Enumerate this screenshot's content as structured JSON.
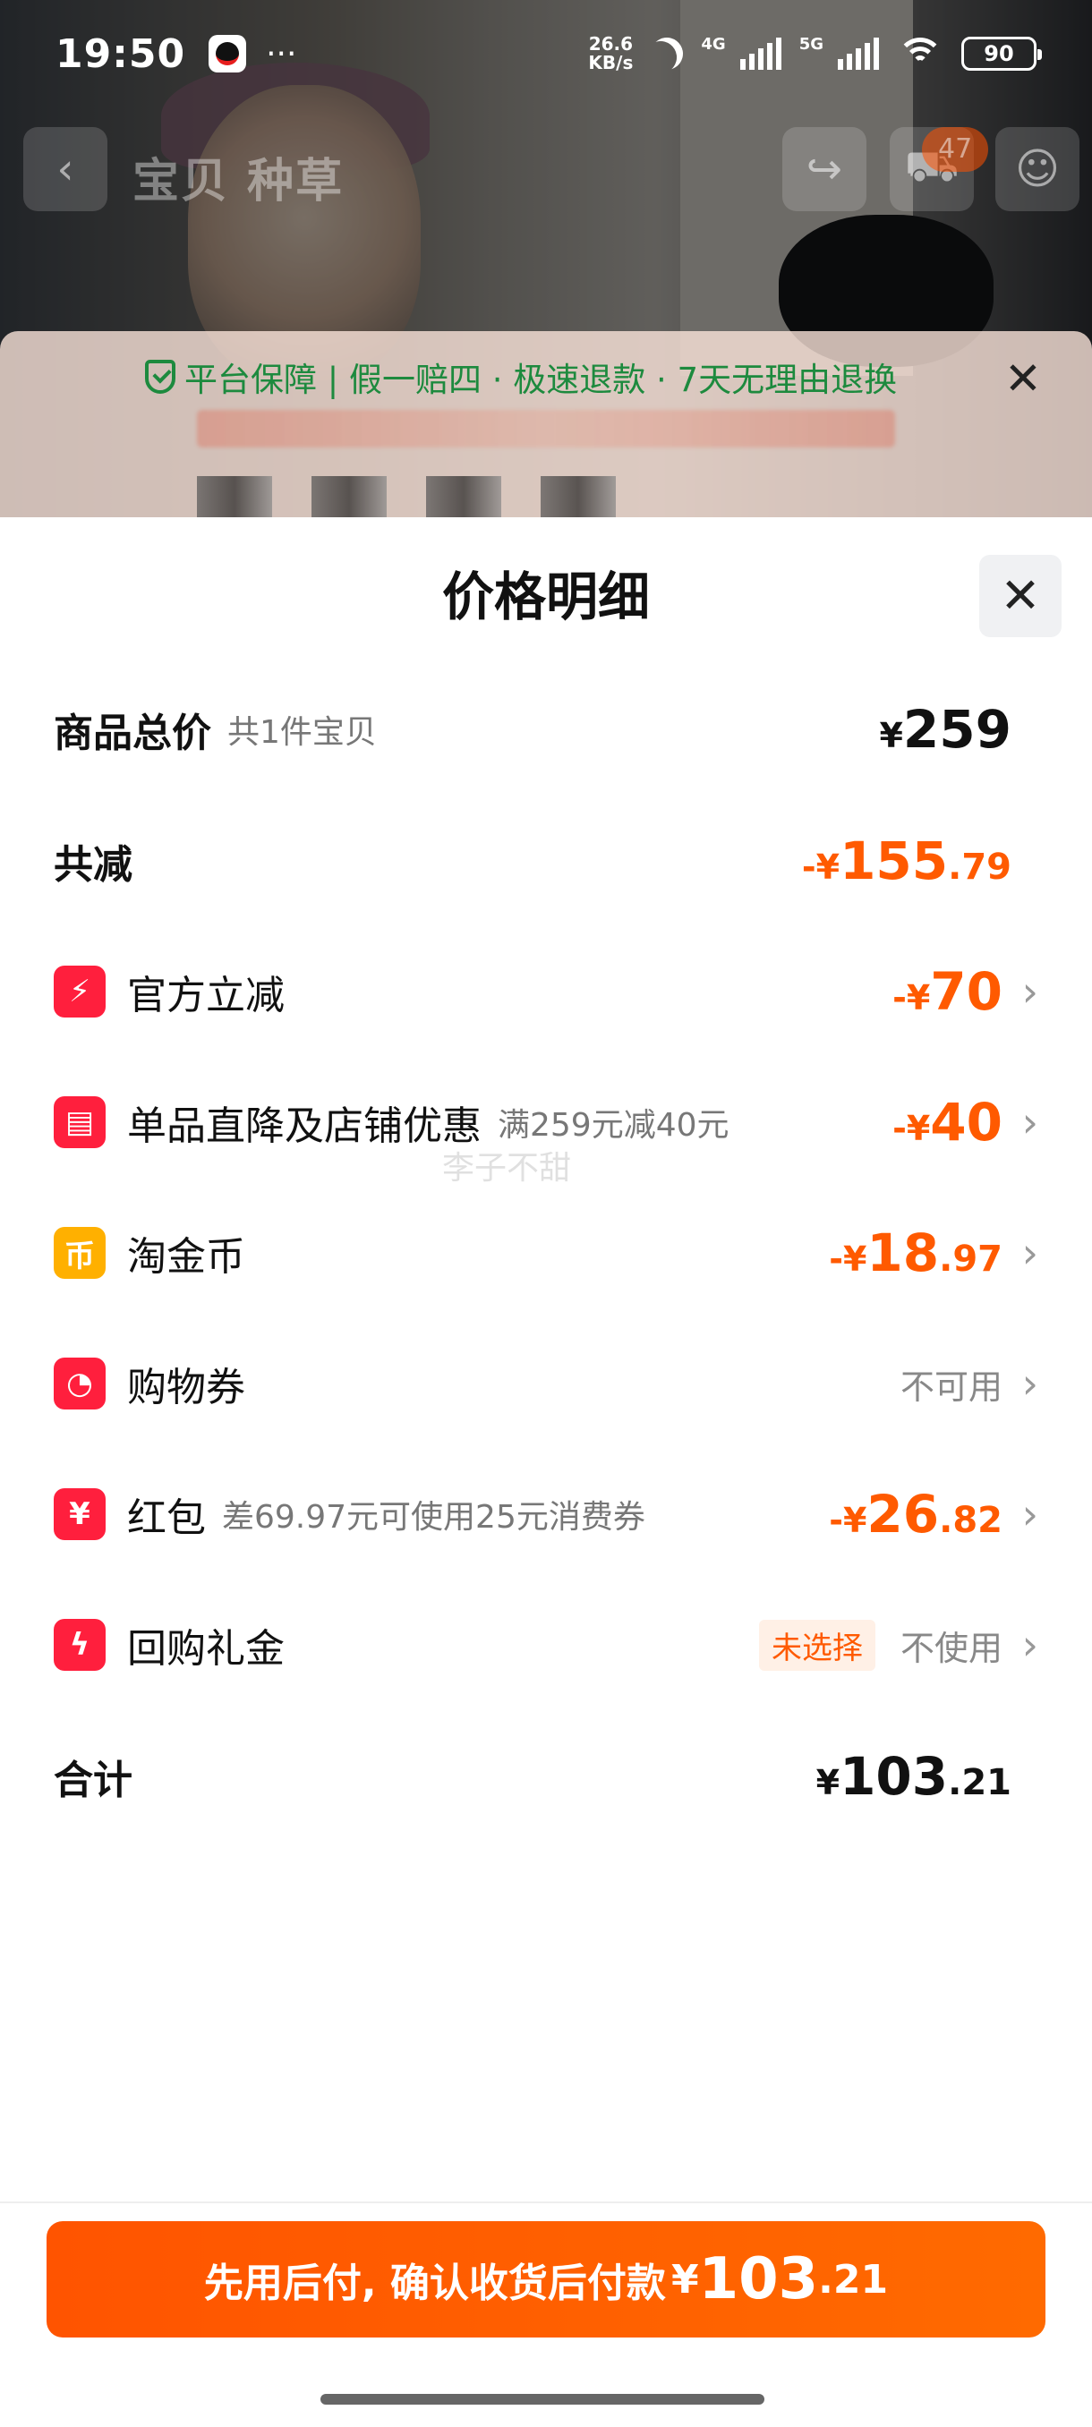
{
  "status_bar": {
    "time": "19:50",
    "more": "···",
    "speed_top": "26.6",
    "speed_bottom": "KB/s",
    "net1": "4G",
    "net2": "5G",
    "battery": "90"
  },
  "app_header": {
    "tabs": "宝贝  种草",
    "cart_badge": "47"
  },
  "guarantee": {
    "text": "平台保障 | 假一赔四 · 极速退款 · 7天无理由退换",
    "close": "✕"
  },
  "sheet": {
    "title": "价格明细",
    "close": "✕",
    "watermark": "李子不甜",
    "rows": [
      {
        "label": "商品总价",
        "sub": "共1件宝贝",
        "sign": "¥",
        "int": "259",
        "dec": ""
      },
      {
        "label": "共减",
        "sub": "",
        "sign": "-¥",
        "int": "155",
        "dec": ".79"
      },
      {
        "label": "官方立减",
        "sub": "",
        "sign": "-¥",
        "int": "70",
        "dec": "",
        "icon": "lightning-icon"
      },
      {
        "label": "单品直降及店铺优惠",
        "sub": "满259元减40元",
        "sign": "-¥",
        "int": "40",
        "dec": "",
        "icon": "shop-icon"
      },
      {
        "label": "淘金币",
        "sub": "",
        "sign": "-¥",
        "int": "18",
        "dec": ".97",
        "icon": "coin-icon"
      },
      {
        "label": "购物券",
        "sub": "",
        "status": "不可用",
        "icon": "coupon-icon"
      },
      {
        "label": "红包",
        "sub": "差69.97元可使用25元消费券",
        "sign": "-¥",
        "int": "26",
        "dec": ".82",
        "icon": "red-envelope-icon"
      },
      {
        "label": "回购礼金",
        "sub": "",
        "tag": "未选择",
        "status": "不使用",
        "icon": "gift-money-icon"
      },
      {
        "label": "合计",
        "sub": "",
        "sign": "¥",
        "int": "103",
        "dec": ".21"
      }
    ]
  },
  "footer": {
    "pay_text": "先用后付, 确认收货后付款",
    "sign": "¥",
    "int": "103",
    "dec": ".21"
  },
  "colors": {
    "accent": "#ff5a00",
    "icon_red": "#ff1f3d",
    "icon_gold": "#ffb000",
    "guarantee_green": "#1d8a3e"
  }
}
